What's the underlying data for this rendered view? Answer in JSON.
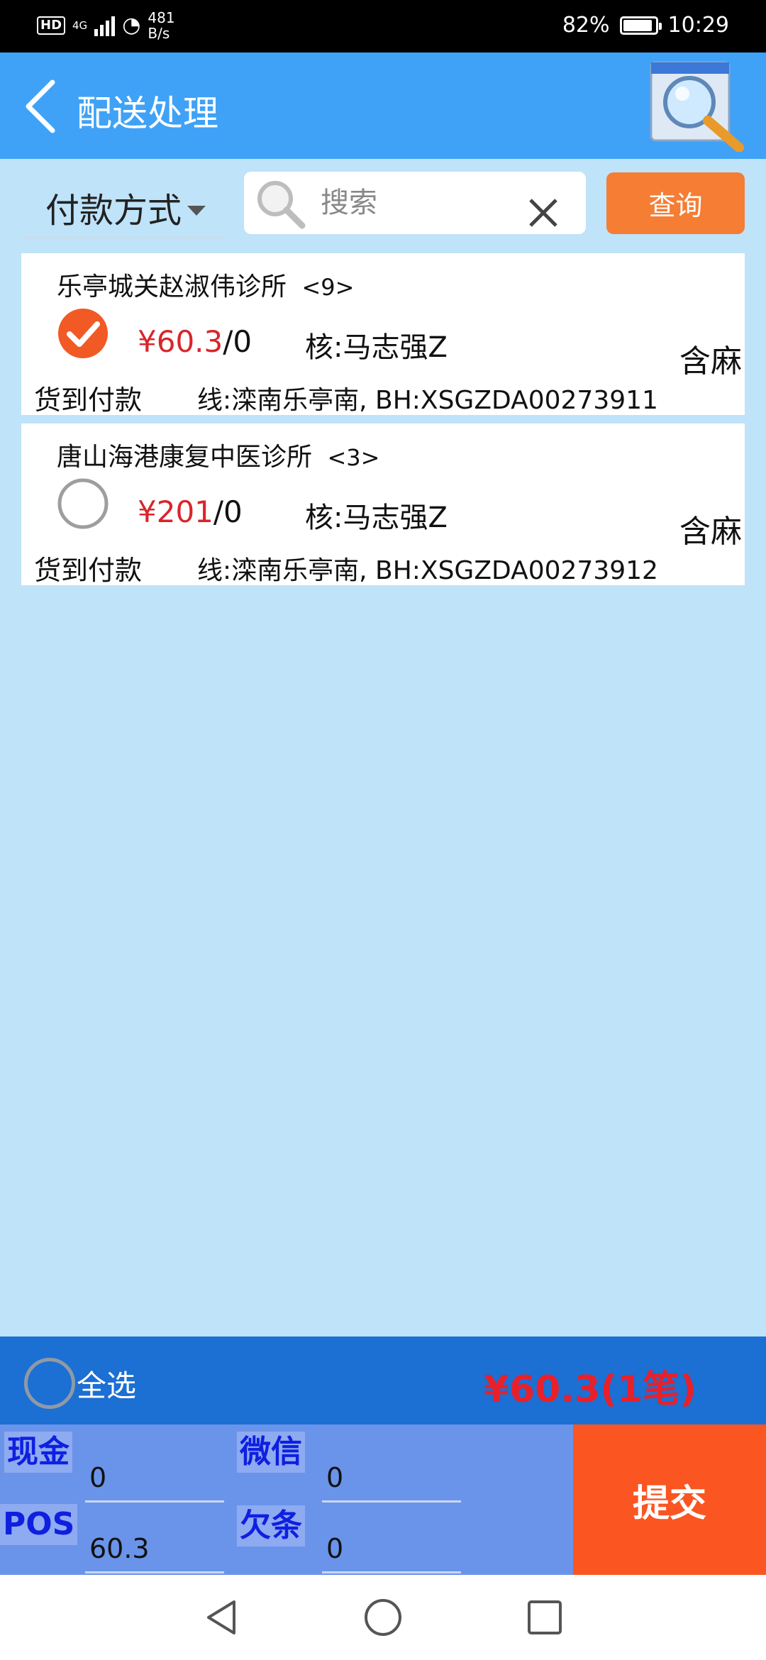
{
  "status_bar": {
    "hd": "HD",
    "network": "4G",
    "speed_value": "481",
    "speed_unit": "B/s",
    "battery": "82%",
    "time": "10:29",
    "icons": [
      "signal-icon",
      "wifi-icon",
      "battery-icon"
    ]
  },
  "header": {
    "title": "配送处理",
    "back_icon": "chevron-left-icon",
    "search_icon": "magnifier-icon"
  },
  "filter": {
    "payment_method_label": "付款方式",
    "search_placeholder": "搜索",
    "search_value": "",
    "query_button": "查询"
  },
  "orders": [
    {
      "name": "乐亭城关赵淑伟诊所",
      "count": "<9>",
      "checked": true,
      "amount": "¥60.3",
      "amount_suffix": "/0",
      "checker": "核:马志强Z",
      "tag": "含麻",
      "payment": "货到付款",
      "line": "线:滦南乐亭南, BH:XSGZDA00273911"
    },
    {
      "name": "唐山海港康复中医诊所",
      "count": "<3>",
      "checked": false,
      "amount": "¥201",
      "amount_suffix": "/0",
      "checker": "核:马志强Z",
      "tag": "含麻",
      "payment": "货到付款",
      "line": "线:滦南乐亭南, BH:XSGZDA00273912"
    }
  ],
  "bottom": {
    "select_all_label": "全选",
    "total": "¥60.3(1笔)",
    "cash_label": "现金",
    "cash_value": "0",
    "wechat_label": "微信",
    "wechat_value": "0",
    "pos_label": "POS",
    "pos_value": "60.3",
    "iou_label": "欠条",
    "iou_value": "0",
    "submit_label": "提交"
  },
  "colors": {
    "header_bg": "#3fa2f6",
    "page_bg": "#bfe3f9",
    "query_button": "#f57d34",
    "submit_button": "#fb5522",
    "price_red": "#d9252a",
    "checked_orange": "#f15a24"
  }
}
